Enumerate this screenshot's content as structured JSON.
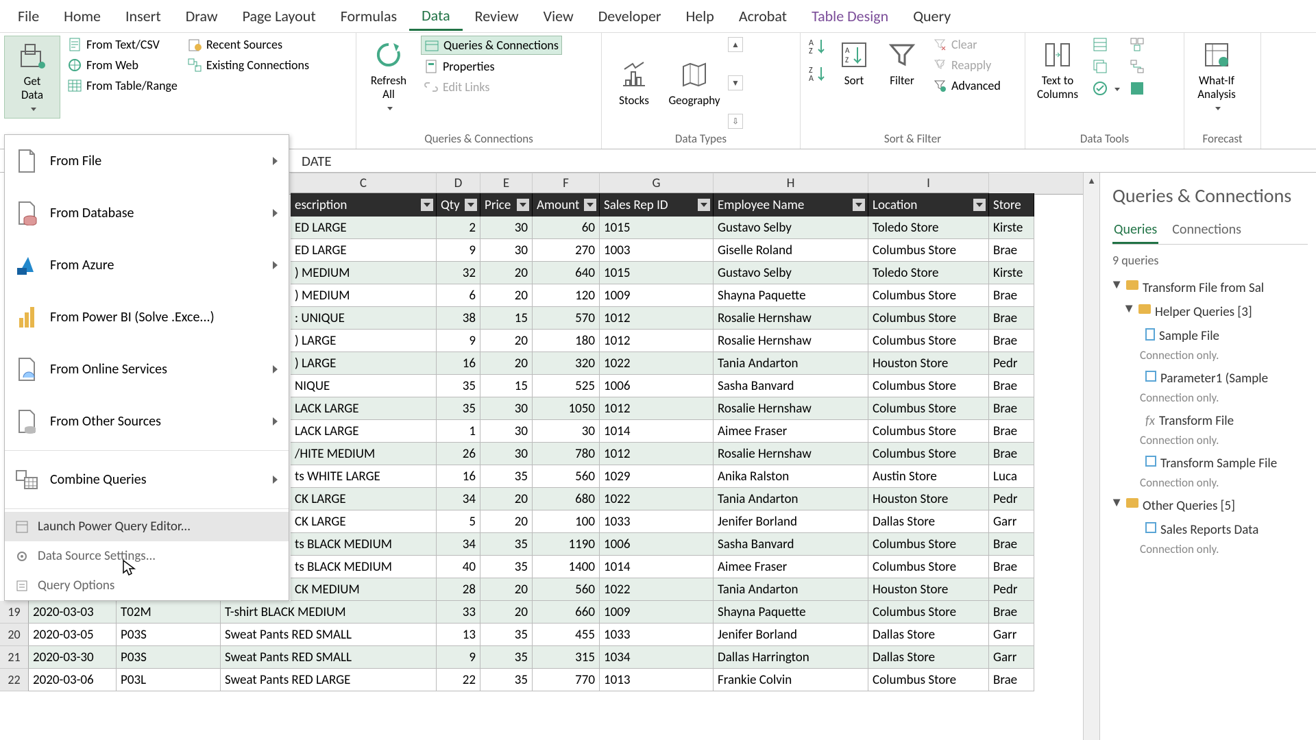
{
  "tabs": [
    "File",
    "Home",
    "Insert",
    "Draw",
    "Page Layout",
    "Formulas",
    "Data",
    "Review",
    "View",
    "Developer",
    "Help",
    "Acrobat",
    "Table Design",
    "Query"
  ],
  "tabs_active": "Data",
  "ribbon": {
    "get_data": "Get\nData",
    "from_text": "From Text/CSV",
    "from_web": "From Web",
    "from_table": "From Table/Range",
    "recent": "Recent Sources",
    "existing": "Existing Connections",
    "refresh": "Refresh\nAll",
    "queries_conn": "Queries & Connections",
    "properties": "Properties",
    "edit_links": "Edit Links",
    "group_qc": "Queries & Connections",
    "stocks": "Stocks",
    "geography": "Geography",
    "group_dt": "Data Types",
    "sort": "Sort",
    "filter": "Filter",
    "clear": "Clear",
    "reapply": "Reapply",
    "advanced": "Advanced",
    "group_sf": "Sort & Filter",
    "text_cols": "Text to\nColumns",
    "group_tools": "Data Tools",
    "whatif": "What-If\nAnalysis",
    "group_fc": "Forecast"
  },
  "getdata_menu": {
    "from_file": "From File",
    "from_database": "From Database",
    "from_azure": "From Azure",
    "from_powerbi": "From Power BI (Solve .Exce...)",
    "from_online": "From Online Services",
    "from_other": "From Other Sources",
    "combine": "Combine Queries",
    "launch": "Launch Power Query Editor...",
    "dss": "Data Source Settings...",
    "qopt": "Query Options"
  },
  "formula_bar": "DATE",
  "col_letters": [
    "C",
    "D",
    "E",
    "F",
    "G",
    "H",
    "I"
  ],
  "headers": {
    "desc": "escription",
    "qty": "Qty",
    "price": "Price",
    "amt": "Amount",
    "rep": "Sales Rep ID",
    "emp": "Employee Name",
    "loc": "Location",
    "store": "Store"
  },
  "rows_top": [
    {
      "desc": "ED LARGE",
      "qty": 2,
      "price": 30,
      "amt": 60,
      "rep": "1015",
      "emp": "Gustavo Selby",
      "loc": "Toledo Store",
      "store": "Kirste"
    },
    {
      "desc": "ED LARGE",
      "qty": 9,
      "price": 30,
      "amt": 270,
      "rep": "1003",
      "emp": "Giselle Roland",
      "loc": "Columbus Store",
      "store": "Brae"
    },
    {
      "desc": ") MEDIUM",
      "qty": 32,
      "price": 20,
      "amt": 640,
      "rep": "1015",
      "emp": "Gustavo Selby",
      "loc": "Toledo Store",
      "store": "Kirste"
    },
    {
      "desc": ") MEDIUM",
      "qty": 6,
      "price": 20,
      "amt": 120,
      "rep": "1009",
      "emp": "Shayna Paquette",
      "loc": "Columbus Store",
      "store": "Brae"
    },
    {
      "desc": ": UNIQUE",
      "qty": 38,
      "price": 15,
      "amt": 570,
      "rep": "1012",
      "emp": "Rosalie Hernshaw",
      "loc": "Columbus Store",
      "store": "Brae"
    },
    {
      "desc": ") LARGE",
      "qty": 9,
      "price": 20,
      "amt": 180,
      "rep": "1012",
      "emp": "Rosalie Hernshaw",
      "loc": "Columbus Store",
      "store": "Brae"
    },
    {
      "desc": ") LARGE",
      "qty": 16,
      "price": 20,
      "amt": 320,
      "rep": "1022",
      "emp": "Tania Andarton",
      "loc": "Houston Store",
      "store": "Pedr"
    },
    {
      "desc": "NIQUE",
      "qty": 35,
      "price": 15,
      "amt": 525,
      "rep": "1006",
      "emp": "Sasha Banvard",
      "loc": "Columbus Store",
      "store": "Brae"
    },
    {
      "desc": "LACK LARGE",
      "qty": 35,
      "price": 30,
      "amt": 1050,
      "rep": "1012",
      "emp": "Rosalie Hernshaw",
      "loc": "Columbus Store",
      "store": "Brae"
    },
    {
      "desc": "LACK LARGE",
      "qty": 1,
      "price": 30,
      "amt": 30,
      "rep": "1014",
      "emp": "Aimee Fraser",
      "loc": "Columbus Store",
      "store": "Brae"
    },
    {
      "desc": "/HITE MEDIUM",
      "qty": 26,
      "price": 30,
      "amt": 780,
      "rep": "1012",
      "emp": "Rosalie Hernshaw",
      "loc": "Columbus Store",
      "store": "Brae"
    },
    {
      "desc": "ts WHITE LARGE",
      "qty": 16,
      "price": 35,
      "amt": 560,
      "rep": "1029",
      "emp": "Anika Ralston",
      "loc": "Austin Store",
      "store": "Luca"
    },
    {
      "desc": "CK LARGE",
      "qty": 34,
      "price": 20,
      "amt": 680,
      "rep": "1022",
      "emp": "Tania Andarton",
      "loc": "Houston Store",
      "store": "Pedr"
    },
    {
      "desc": "CK LARGE",
      "qty": 5,
      "price": 20,
      "amt": 100,
      "rep": "1033",
      "emp": "Jenifer Borland",
      "loc": "Dallas Store",
      "store": "Garr"
    },
    {
      "desc": "ts BLACK MEDIUM",
      "qty": 34,
      "price": 35,
      "amt": 1190,
      "rep": "1006",
      "emp": "Sasha Banvard",
      "loc": "Columbus Store",
      "store": "Brae"
    },
    {
      "desc": "ts BLACK MEDIUM",
      "qty": 40,
      "price": 35,
      "amt": 1400,
      "rep": "1014",
      "emp": "Aimee Fraser",
      "loc": "Columbus Store",
      "store": "Brae"
    },
    {
      "desc": "CK MEDIUM",
      "qty": 28,
      "price": 20,
      "amt": 560,
      "rep": "1022",
      "emp": "Tania Andarton",
      "loc": "Houston Store",
      "store": "Pedr"
    }
  ],
  "rows_bottom": [
    {
      "n": 19,
      "date": "2020-03-03",
      "code": "T02M",
      "desc": "T-shirt BLACK MEDIUM",
      "qty": 33,
      "price": 20,
      "amt": 660,
      "rep": "1009",
      "emp": "Shayna Paquette",
      "loc": "Columbus Store",
      "store": "Brae"
    },
    {
      "n": 20,
      "date": "2020-03-05",
      "code": "P03S",
      "desc": "Sweat Pants RED SMALL",
      "qty": 13,
      "price": 35,
      "amt": 455,
      "rep": "1033",
      "emp": "Jenifer Borland",
      "loc": "Dallas Store",
      "store": "Garr"
    },
    {
      "n": 21,
      "date": "2020-03-30",
      "code": "P03S",
      "desc": "Sweat Pants RED SMALL",
      "qty": 9,
      "price": 35,
      "amt": 315,
      "rep": "1034",
      "emp": "Dallas Harrington",
      "loc": "Dallas Store",
      "store": "Garr"
    },
    {
      "n": 22,
      "date": "2020-03-06",
      "code": "P03L",
      "desc": "Sweat Pants RED LARGE",
      "qty": 22,
      "price": 35,
      "amt": 770,
      "rep": "1013",
      "emp": "Frankie Colvin",
      "loc": "Columbus Store",
      "store": "Brae"
    }
  ],
  "panel": {
    "title": "Queries & Connections",
    "tab_q": "Queries",
    "tab_c": "Connections",
    "count": "9 queries",
    "g1": "Transform File from Sal",
    "g1a": "Helper Queries [3]",
    "i_sample": "Sample File",
    "i_param": "Parameter1 (Sample",
    "i_tf": "Transform File",
    "i_tsf": "Transform Sample File",
    "conn_only": "Connection only.",
    "g2": "Other Queries [5]",
    "i_srd": "Sales Reports Data"
  }
}
